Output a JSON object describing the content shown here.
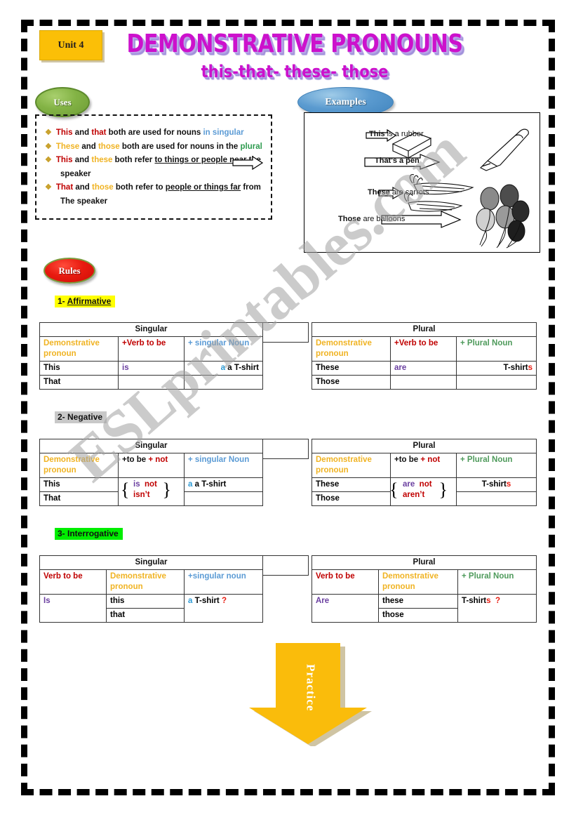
{
  "header": {
    "unit_badge": "Unit 4",
    "title": "DEMONSTRATIVE PRONOUNS",
    "subtitle": "this-that- these- those"
  },
  "labels": {
    "uses": "Uses",
    "examples": "Examples",
    "rules": "Rules"
  },
  "uses": {
    "bullet_glyph": "❖",
    "items": [
      {
        "parts": [
          {
            "t": "This",
            "c": "red"
          },
          {
            "t": " and ",
            "c": "black"
          },
          {
            "t": "that",
            "c": "red"
          },
          {
            "t": " both are used for nouns ",
            "c": "black"
          },
          {
            "t": "in singular",
            "c": "blue"
          }
        ]
      },
      {
        "parts": [
          {
            "t": "These",
            "c": "gold"
          },
          {
            "t": " and ",
            "c": "black"
          },
          {
            "t": "those",
            "c": "gold"
          },
          {
            "t": " both are used for nouns in the ",
            "c": "black"
          },
          {
            "t": "plural",
            "c": "green"
          }
        ]
      },
      {
        "parts": [
          {
            "t": "This",
            "c": "red"
          },
          {
            "t": " and ",
            "c": "black"
          },
          {
            "t": "these",
            "c": "gold"
          },
          {
            "t": " both refer ",
            "c": "black"
          },
          {
            "t": "to ",
            "c": "black-u"
          },
          {
            "t": "things or people near",
            "c": "black-ub"
          },
          {
            "t": " the",
            "c": "black"
          }
        ]
      },
      {
        "continuation": "speaker"
      },
      {
        "parts": [
          {
            "t": "That",
            "c": "red"
          },
          {
            "t": " and ",
            "c": "black"
          },
          {
            "t": "those",
            "c": "gold"
          },
          {
            "t": " both refer to ",
            "c": "black"
          },
          {
            "t": "people or things far",
            "c": "black-ub"
          },
          {
            "t": " from",
            "c": "black"
          }
        ]
      },
      {
        "continuation": "The speaker"
      }
    ]
  },
  "examples": {
    "lines": [
      {
        "bold": "This",
        "rest": " is a rubber"
      },
      {
        "bold": "That's a pen",
        "rest": ""
      },
      {
        "bold": "These",
        "rest": " are carrots"
      },
      {
        "bold": "Those",
        "rest": " are balloons"
      }
    ],
    "images": [
      "rubber-eraser",
      "pen",
      "carrots",
      "balloons"
    ]
  },
  "sections": [
    {
      "number": "1-",
      "label": "Affirmative",
      "highlight": "#FFFF00"
    },
    {
      "number": "2-",
      "label": "Negative",
      "highlight": "#C8C8C8"
    },
    {
      "number": "3-",
      "label": "Interrogative",
      "highlight": "#00EE00"
    }
  ],
  "tables": {
    "affirmative": {
      "singular": {
        "title": "Singular",
        "headers": [
          "Demonstrative pronoun",
          "+Verb to be",
          "+ singular Noun"
        ],
        "rows": [
          [
            "This",
            "is",
            "a T-shirt"
          ],
          [
            "That",
            "",
            ""
          ]
        ]
      },
      "plural": {
        "title": "Plural",
        "headers": [
          "Demonstrative pronoun",
          "+Verb to be",
          "+ Plural Noun"
        ],
        "rows": [
          [
            "These",
            "are",
            "T-shirts"
          ],
          [
            "Those",
            "",
            ""
          ]
        ]
      }
    },
    "negative": {
      "singular": {
        "title": "Singular",
        "headers": [
          "Demonstrative pronoun",
          "+to be + not",
          "+ singular Noun"
        ],
        "rows": [
          [
            "This",
            "is  not",
            "a T-shirt"
          ],
          [
            "That",
            "isn’t",
            ""
          ]
        ]
      },
      "plural": {
        "title": "Plural",
        "headers": [
          "Demonstrative pronoun",
          "+to be + not",
          "+ Plural Noun"
        ],
        "rows": [
          [
            "These",
            "are  not",
            "T-shirts"
          ],
          [
            "Those",
            "aren’t",
            ""
          ]
        ]
      }
    },
    "interrogative": {
      "singular": {
        "title": "Singular",
        "headers": [
          "Verb to be",
          "Demonstrative pronoun",
          "+singular noun"
        ],
        "rows": [
          [
            "Is",
            "this",
            "a T-shirt ?"
          ],
          [
            "",
            "that",
            ""
          ]
        ]
      },
      "plural": {
        "title": "Plural",
        "headers": [
          "Verb to be",
          "Demonstrative pronoun",
          "+ Plural Noun"
        ],
        "rows": [
          [
            "Are",
            "these",
            "T-shirts  ?"
          ],
          [
            "",
            "those",
            ""
          ]
        ]
      }
    }
  },
  "practice": {
    "label": "Practice",
    "arrow_color": "#FABC0B"
  },
  "watermark": {
    "text": "ESLprintables.com"
  },
  "colors": {
    "gold": "#F0B323",
    "red": "#C00000",
    "blue": "#5B9BD5",
    "green": "#4E9A5B",
    "purple": "#6A3FA0",
    "badge_gold": "#FBBF07",
    "title_magenta": "#CC11CC"
  }
}
